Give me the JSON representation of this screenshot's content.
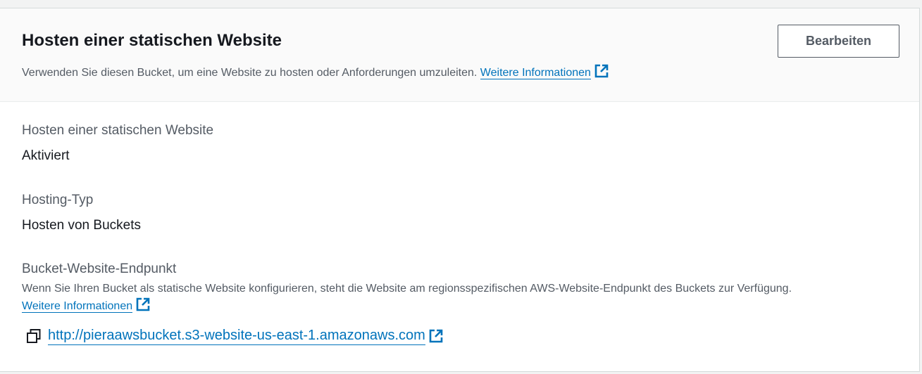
{
  "panel": {
    "title": "Hosten einer statischen Website",
    "description": "Verwenden Sie diesen Bucket, um eine Website zu hosten oder Anforderungen umzuleiten.",
    "more_info_link": "Weitere Informationen",
    "edit_button": "Bearbeiten"
  },
  "fields": {
    "static_hosting": {
      "label": "Hosten einer statischen Website",
      "value": "Aktiviert"
    },
    "hosting_type": {
      "label": "Hosting-Typ",
      "value": "Hosten von Buckets"
    },
    "endpoint": {
      "label": "Bucket-Website-Endpunkt",
      "description": "Wenn Sie Ihren Bucket als statische Website konfigurieren, steht die Website am regionsspezifischen AWS-Website-Endpunkt des Buckets zur Verfügung.",
      "more_info_link": "Weitere Informationen",
      "url": "http://pieraawsbucket.s3-website-us-east-1.amazonaws.com"
    }
  },
  "colors": {
    "link": "#0073bb",
    "text": "#16191f",
    "secondary_text": "#545b64",
    "header_bg": "#fafafa",
    "page_bg": "#f2f3f3"
  },
  "icons": {
    "external_link": "external-link-icon",
    "copy": "copy-icon"
  }
}
